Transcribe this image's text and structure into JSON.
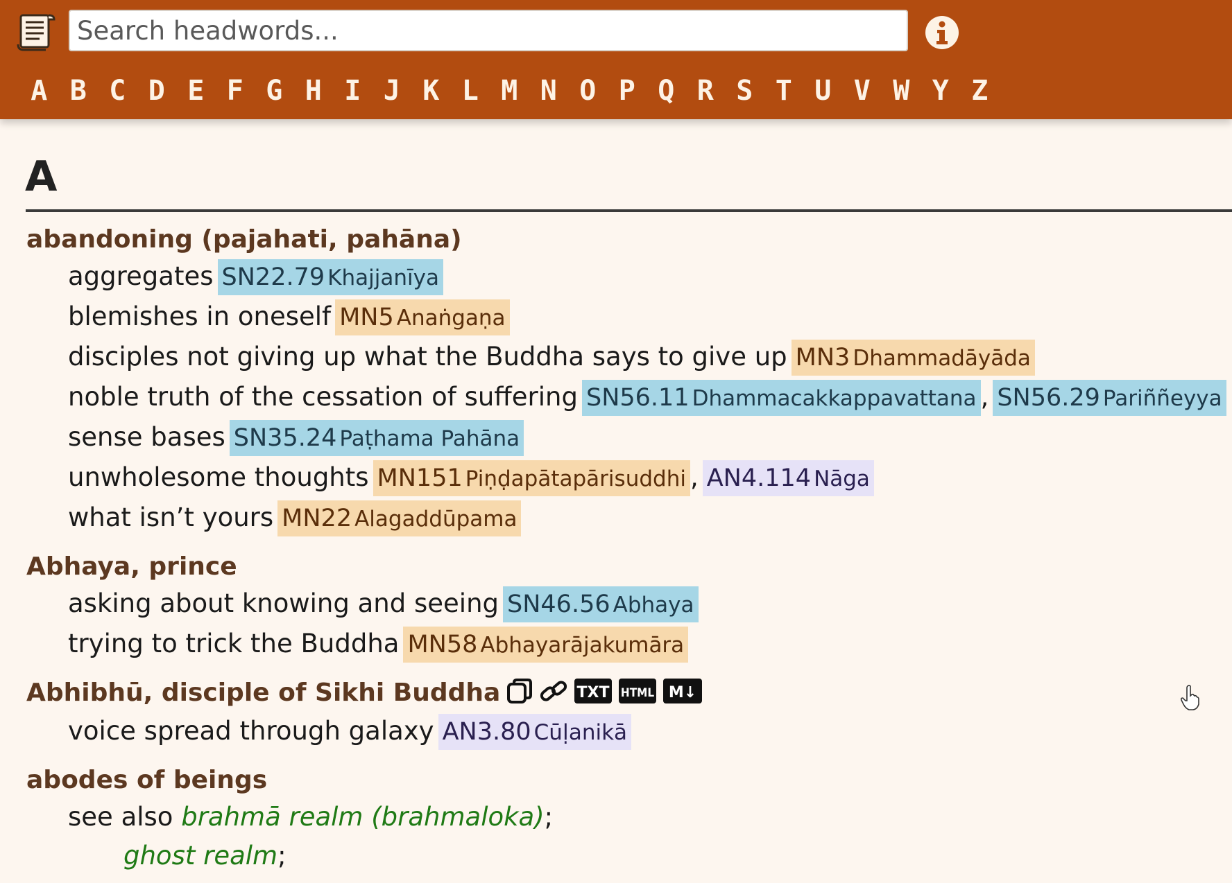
{
  "header": {
    "search_placeholder": "Search headwords...",
    "letters": [
      "A",
      "B",
      "C",
      "D",
      "E",
      "F",
      "G",
      "H",
      "I",
      "J",
      "K",
      "L",
      "M",
      "N",
      "O",
      "P",
      "Q",
      "R",
      "S",
      "T",
      "U",
      "V",
      "W",
      "Y",
      "Z"
    ]
  },
  "section": {
    "title": "A"
  },
  "entries": {
    "abandoning": {
      "head": "abandoning (pajahati, pahāna)",
      "sub": [
        {
          "text": "aggregates",
          "refs": [
            {
              "code": "SN22.79",
              "name": "Khajjanīya"
            }
          ]
        },
        {
          "text": "blemishes in oneself",
          "refs": [
            {
              "code": "MN5",
              "name": "Anaṅgaṇa"
            }
          ]
        },
        {
          "text": "disciples not giving up what the Buddha says to give up",
          "refs": [
            {
              "code": "MN3",
              "name": "Dhammadāyāda"
            }
          ]
        },
        {
          "text": "noble truth of the cessation of suffering",
          "refs": [
            {
              "code": "SN56.11",
              "name": "Dhammacakkappavattana"
            },
            {
              "code": "SN56.29",
              "name": "Pariññeyya"
            }
          ]
        },
        {
          "text": "sense bases",
          "refs": [
            {
              "code": "SN35.24",
              "name": "Paṭhama Pahāna"
            }
          ]
        },
        {
          "text": "unwholesome thoughts",
          "refs": [
            {
              "code": "MN151",
              "name": "Piṇḍapātapārisuddhi"
            },
            {
              "code": "AN4.114",
              "name": "Nāga"
            }
          ]
        },
        {
          "text": "what isn’t yours",
          "refs": [
            {
              "code": "MN22",
              "name": "Alagaddūpama"
            }
          ]
        }
      ]
    },
    "abhaya": {
      "head": "Abhaya, prince",
      "sub": [
        {
          "text": "asking about knowing and seeing",
          "refs": [
            {
              "code": "SN46.56",
              "name": "Abhaya"
            }
          ]
        },
        {
          "text": "trying to trick the Buddha",
          "refs": [
            {
              "code": "MN58",
              "name": "Abhayarājakumāra"
            }
          ]
        }
      ]
    },
    "abhibhu": {
      "head": "Abhibhū, disciple of Sikhi Buddha",
      "tools": {
        "txt": "TXT",
        "html": "HTML",
        "md": "M↓"
      },
      "sub": [
        {
          "text": "voice spread through galaxy",
          "refs": [
            {
              "code": "AN3.80",
              "name": "Cūḷanikā"
            }
          ]
        }
      ]
    },
    "abodes": {
      "head": "abodes of beings",
      "see_also_label": "see also",
      "links": [
        "brahmā realm (brahmaloka)",
        "ghost realm"
      ],
      "punct": ";"
    }
  },
  "colors": {
    "header_bg": "#b24c10",
    "page_bg": "#fdf6ef",
    "sn_bg": "#a6d6e6",
    "mn_bg": "#f7d9ad",
    "an_bg": "#e6e2f7",
    "link_green": "#1f7a15"
  },
  "icons": [
    "scroll-logo-icon",
    "info-icon",
    "copy-icon",
    "link-icon",
    "txt-icon",
    "html-icon",
    "markdown-icon",
    "hand-cursor-icon"
  ]
}
